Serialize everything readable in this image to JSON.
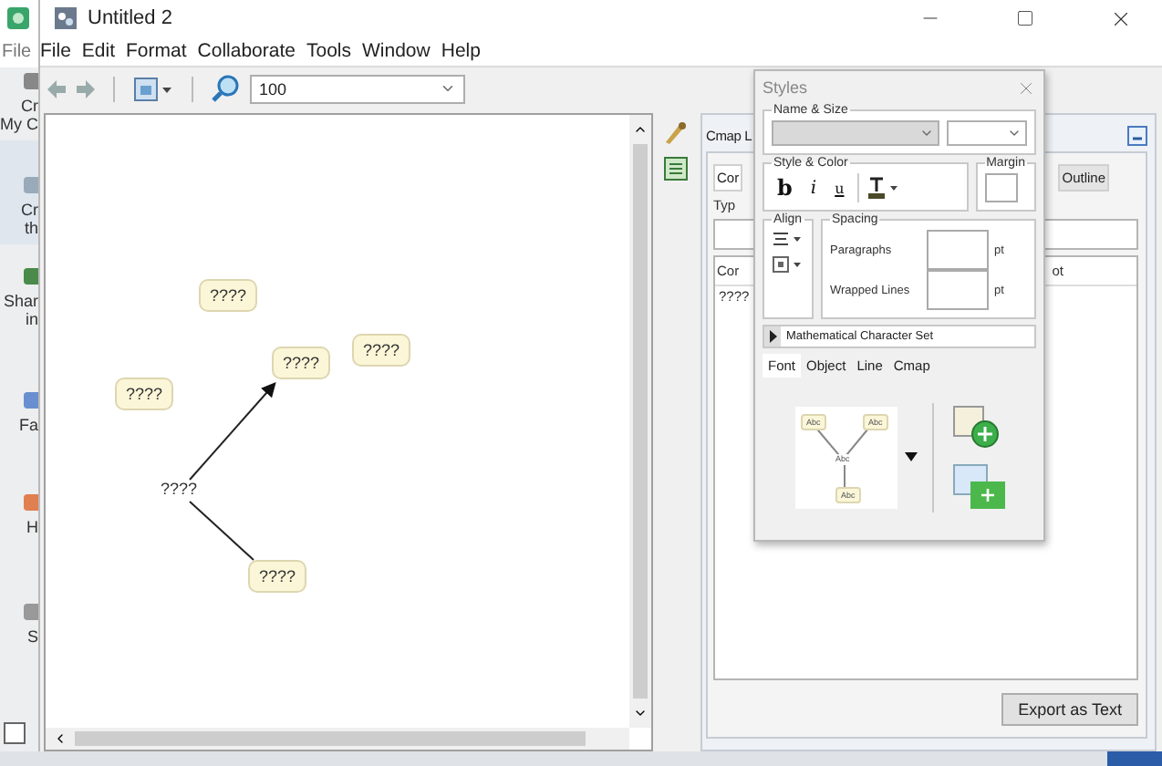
{
  "background_window": {
    "menu_item": "File",
    "sidebar": [
      {
        "lines": [
          "Cr",
          "My C"
        ],
        "selected": false
      },
      {
        "lines": [
          "Cr",
          "th"
        ],
        "selected": true
      },
      {
        "lines": [
          "Shar",
          "in"
        ],
        "selected": false
      },
      {
        "lines": [
          "Fa"
        ],
        "selected": false
      },
      {
        "lines": [
          "H"
        ],
        "selected": false
      },
      {
        "lines": [
          "S"
        ],
        "selected": false
      }
    ],
    "checkbox": {
      "checked": false
    }
  },
  "window": {
    "title": "Untitled 2"
  },
  "menu": [
    "File",
    "Edit",
    "Format",
    "Collaborate",
    "Tools",
    "Window",
    "Help"
  ],
  "toolbar": {
    "zoom": "100"
  },
  "canvas": {
    "concepts": [
      "????",
      "????",
      "????",
      "????",
      "????"
    ],
    "linking_phrase": "????"
  },
  "cmap_panel": {
    "title": "Cmap L",
    "tabs": [
      {
        "label": "Cor",
        "selected": true
      },
      {
        "label": "Outline",
        "selected": false
      }
    ],
    "field_label": "Typ",
    "columns": [
      "Cor",
      "ot"
    ],
    "rows": [
      "????"
    ],
    "export_button": "Export as Text"
  },
  "styles": {
    "title": "Styles",
    "name_size": "Name & Size",
    "style_color": "Style & Color",
    "bold": "b",
    "italic": "i",
    "underline": "u",
    "margin": "Margin",
    "align": "Align",
    "spacing": "Spacing",
    "paragraphs": "Paragraphs",
    "wrapped_lines": "Wrapped Lines",
    "units": [
      "pt",
      "pt"
    ],
    "char_set": "Mathematical Character Set",
    "tabs": [
      {
        "label": "Font",
        "selected": true
      },
      {
        "label": "Object",
        "selected": false
      },
      {
        "label": "Line",
        "selected": false
      },
      {
        "label": "Cmap",
        "selected": false
      }
    ],
    "preview_labels": [
      "Abc",
      "Abc",
      "Abc",
      "Abc"
    ]
  }
}
